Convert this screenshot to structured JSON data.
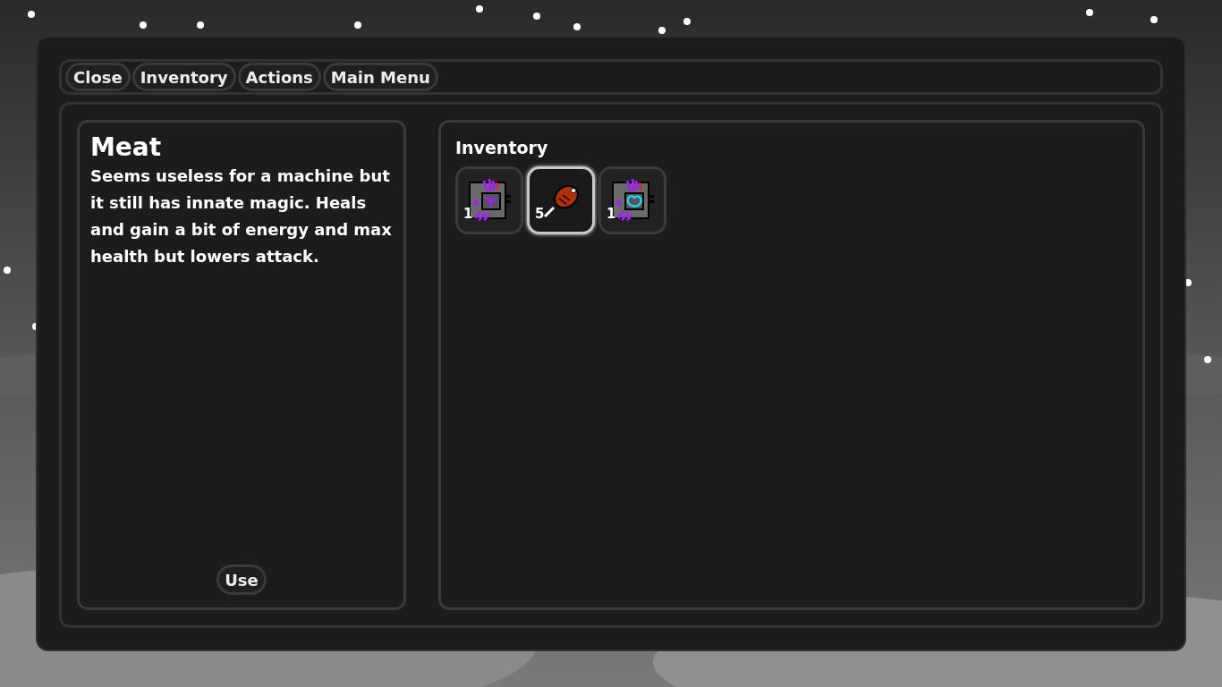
{
  "menu": [
    {
      "label": "Close"
    },
    {
      "label": "Inventory"
    },
    {
      "label": "Actions"
    },
    {
      "label": "Main Menu"
    }
  ],
  "details": {
    "title": "Meat",
    "description": "Seems useless for a machine but it still has innate magic. Heals and gain a bit of energy and max health but lowers attack.",
    "action": "Use"
  },
  "inventory": {
    "title": "Inventory",
    "items": [
      {
        "kind": "trident-chip",
        "count": "1",
        "selected": false
      },
      {
        "kind": "meat",
        "count": "5",
        "selected": true
      },
      {
        "kind": "swirl-chip",
        "count": "1",
        "selected": false
      }
    ]
  }
}
